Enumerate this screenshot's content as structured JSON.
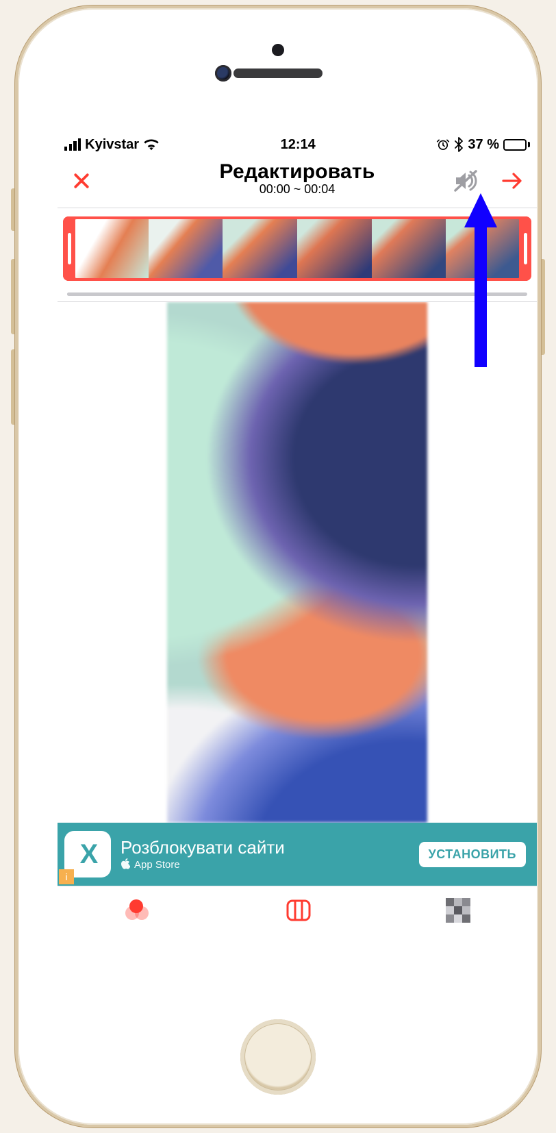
{
  "status": {
    "carrier": "Kyivstar",
    "time": "12:14",
    "battery_pct": "37 %"
  },
  "nav": {
    "title": "Редактировать",
    "subtitle": "00:00 ~ 00:04"
  },
  "ad": {
    "icon_letter": "X",
    "title": "Розблокувати сайти",
    "subtitle": "App Store",
    "cta": "УСТАНОВИТЬ",
    "tag": "i"
  },
  "colors": {
    "accent": "#ff3b30",
    "ad_bg": "#3aa3a9",
    "annotation": "#1100ff"
  }
}
